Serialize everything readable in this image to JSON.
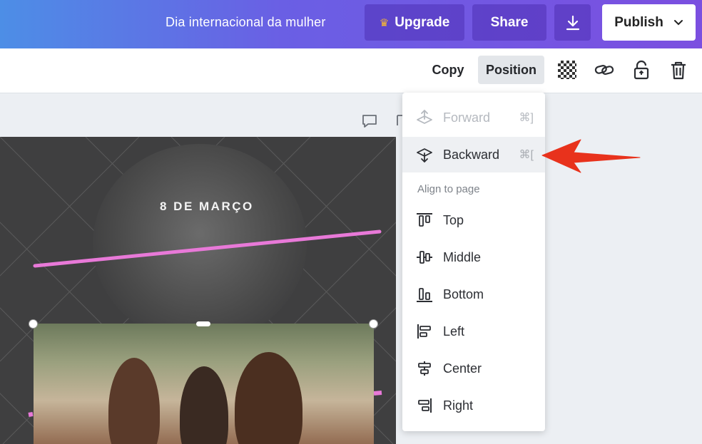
{
  "header": {
    "doc_title": "Dia internacional da mulher",
    "upgrade_label": "Upgrade",
    "share_label": "Share",
    "publish_label": "Publish"
  },
  "toolbar": {
    "copy_label": "Copy",
    "position_label": "Position"
  },
  "design": {
    "date_text": "8 DE MARÇO"
  },
  "position_menu": {
    "forward": {
      "label": "Forward",
      "shortcut": "⌘]"
    },
    "backward": {
      "label": "Backward",
      "shortcut": "⌘["
    },
    "align_heading": "Align to page",
    "align_items": {
      "top": "Top",
      "middle": "Middle",
      "bottom": "Bottom",
      "left": "Left",
      "center": "Center",
      "right": "Right"
    }
  },
  "colors": {
    "accent_pink": "#e879d8",
    "arrow_red": "#e8321c",
    "header_gradient_start": "#4d8ee6",
    "header_gradient_end": "#7b4fe0"
  }
}
